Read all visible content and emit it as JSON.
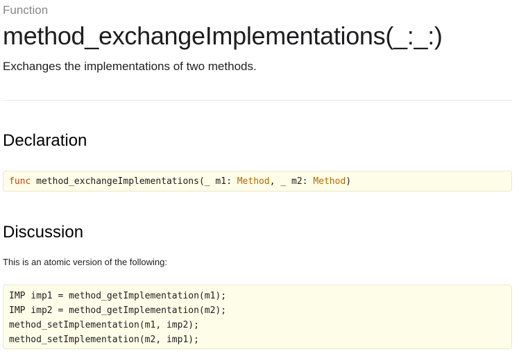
{
  "header": {
    "kind": "Function",
    "title": "method_exchangeImplementations(_:_:)",
    "abstract": "Exchanges the implementations of two methods."
  },
  "declaration": {
    "heading": "Declaration",
    "tokens": {
      "keyword": "func",
      "name": " method_exchangeImplementations(_ m1: ",
      "type1": "Method",
      "sep": ", _ m2: ",
      "type2": "Method",
      "close": ")"
    }
  },
  "discussion": {
    "heading": "Discussion",
    "text": "This is an atomic version of the following:",
    "code_lines": [
      "IMP imp1 = method_getImplementation(m1);",
      "IMP imp2 = method_getImplementation(m2);",
      "method_setImplementation(m1, imp2);",
      "method_setImplementation(m2, imp1);"
    ]
  },
  "colors": {
    "keyword": "#c4420c",
    "type": "#b66700",
    "code_background": "#fefde8"
  }
}
